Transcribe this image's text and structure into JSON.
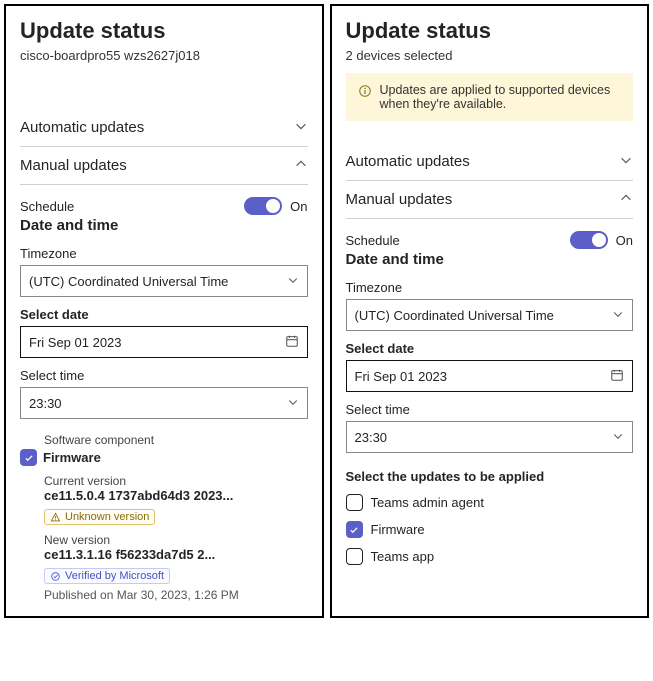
{
  "left": {
    "title": "Update status",
    "device": "cisco-boardpro55 wzs2627j018",
    "sections": {
      "automatic": "Automatic updates",
      "manual": "Manual updates"
    },
    "schedule_label": "Schedule",
    "schedule_on": "On",
    "date_time_header": "Date and time",
    "timezone_label": "Timezone",
    "timezone_value": "(UTC) Coordinated Universal Time",
    "select_date_label": "Select date",
    "select_date_value": "Fri Sep 01 2023",
    "select_time_label": "Select time",
    "select_time_value": "23:30",
    "component_label": "Software component",
    "component_name": "Firmware",
    "current_label": "Current version",
    "current_value": "ce11.5.0.4 1737abd64d3 2023...",
    "unknown_badge": "Unknown version",
    "new_label": "New version",
    "new_value": "ce11.3.1.16 f56233da7d5 2...",
    "verified_badge": "Verified by Microsoft",
    "published": "Published on Mar 30, 2023, 1:26 PM"
  },
  "right": {
    "title": "Update status",
    "device": "2 devices selected",
    "banner": "Updates are applied to supported devices when they're available.",
    "sections": {
      "automatic": "Automatic updates",
      "manual": "Manual updates"
    },
    "schedule_label": "Schedule",
    "schedule_on": "On",
    "date_time_header": "Date and time",
    "timezone_label": "Timezone",
    "timezone_value": "(UTC) Coordinated Universal Time",
    "select_date_label": "Select date",
    "select_date_value": "Fri Sep 01 2023",
    "select_time_label": "Select time",
    "select_time_value": "23:30",
    "apply_header": "Select the updates to be applied",
    "updates": {
      "teams_admin": "Teams admin agent",
      "firmware": "Firmware",
      "teams_app": "Teams app"
    }
  }
}
